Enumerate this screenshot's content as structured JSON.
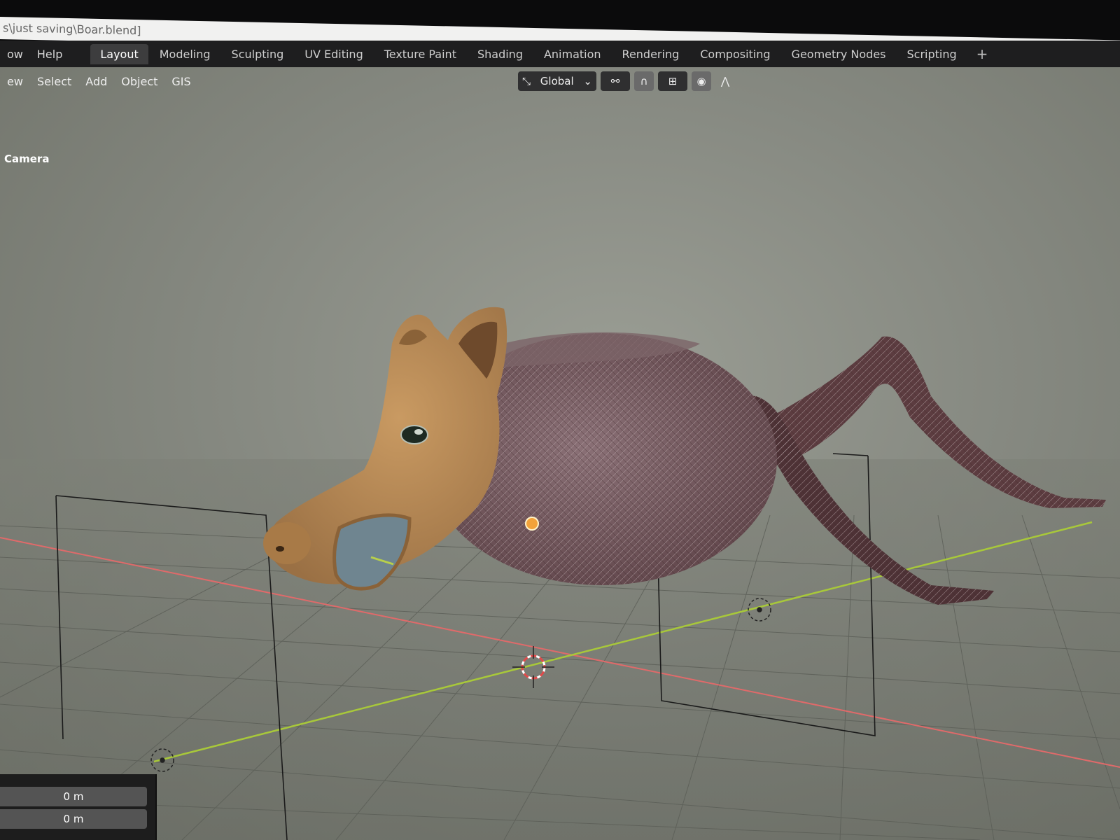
{
  "window": {
    "title": "s\\just saving\\Boar.blend]"
  },
  "topbar": {
    "menus": [
      "ow",
      "Help"
    ],
    "workspaces": [
      "Layout",
      "Modeling",
      "Sculpting",
      "UV Editing",
      "Texture Paint",
      "Shading",
      "Animation",
      "Rendering",
      "Compositing",
      "Geometry Nodes",
      "Scripting"
    ],
    "active_workspace": "Layout",
    "add_tab": "+"
  },
  "viewport": {
    "menus": [
      "ew",
      "Select",
      "Add",
      "Object",
      "GIS"
    ],
    "transform_orientation": "Global",
    "camera_label": "Camera"
  },
  "panel": {
    "fields": [
      "0 m",
      "0 m"
    ]
  },
  "colors": {
    "x_axis": "#e06a6a",
    "y_axis": "#a8c83a",
    "skin": "#b88a55",
    "fur": "#7a5a5e",
    "legs": "#5a3a3c"
  }
}
